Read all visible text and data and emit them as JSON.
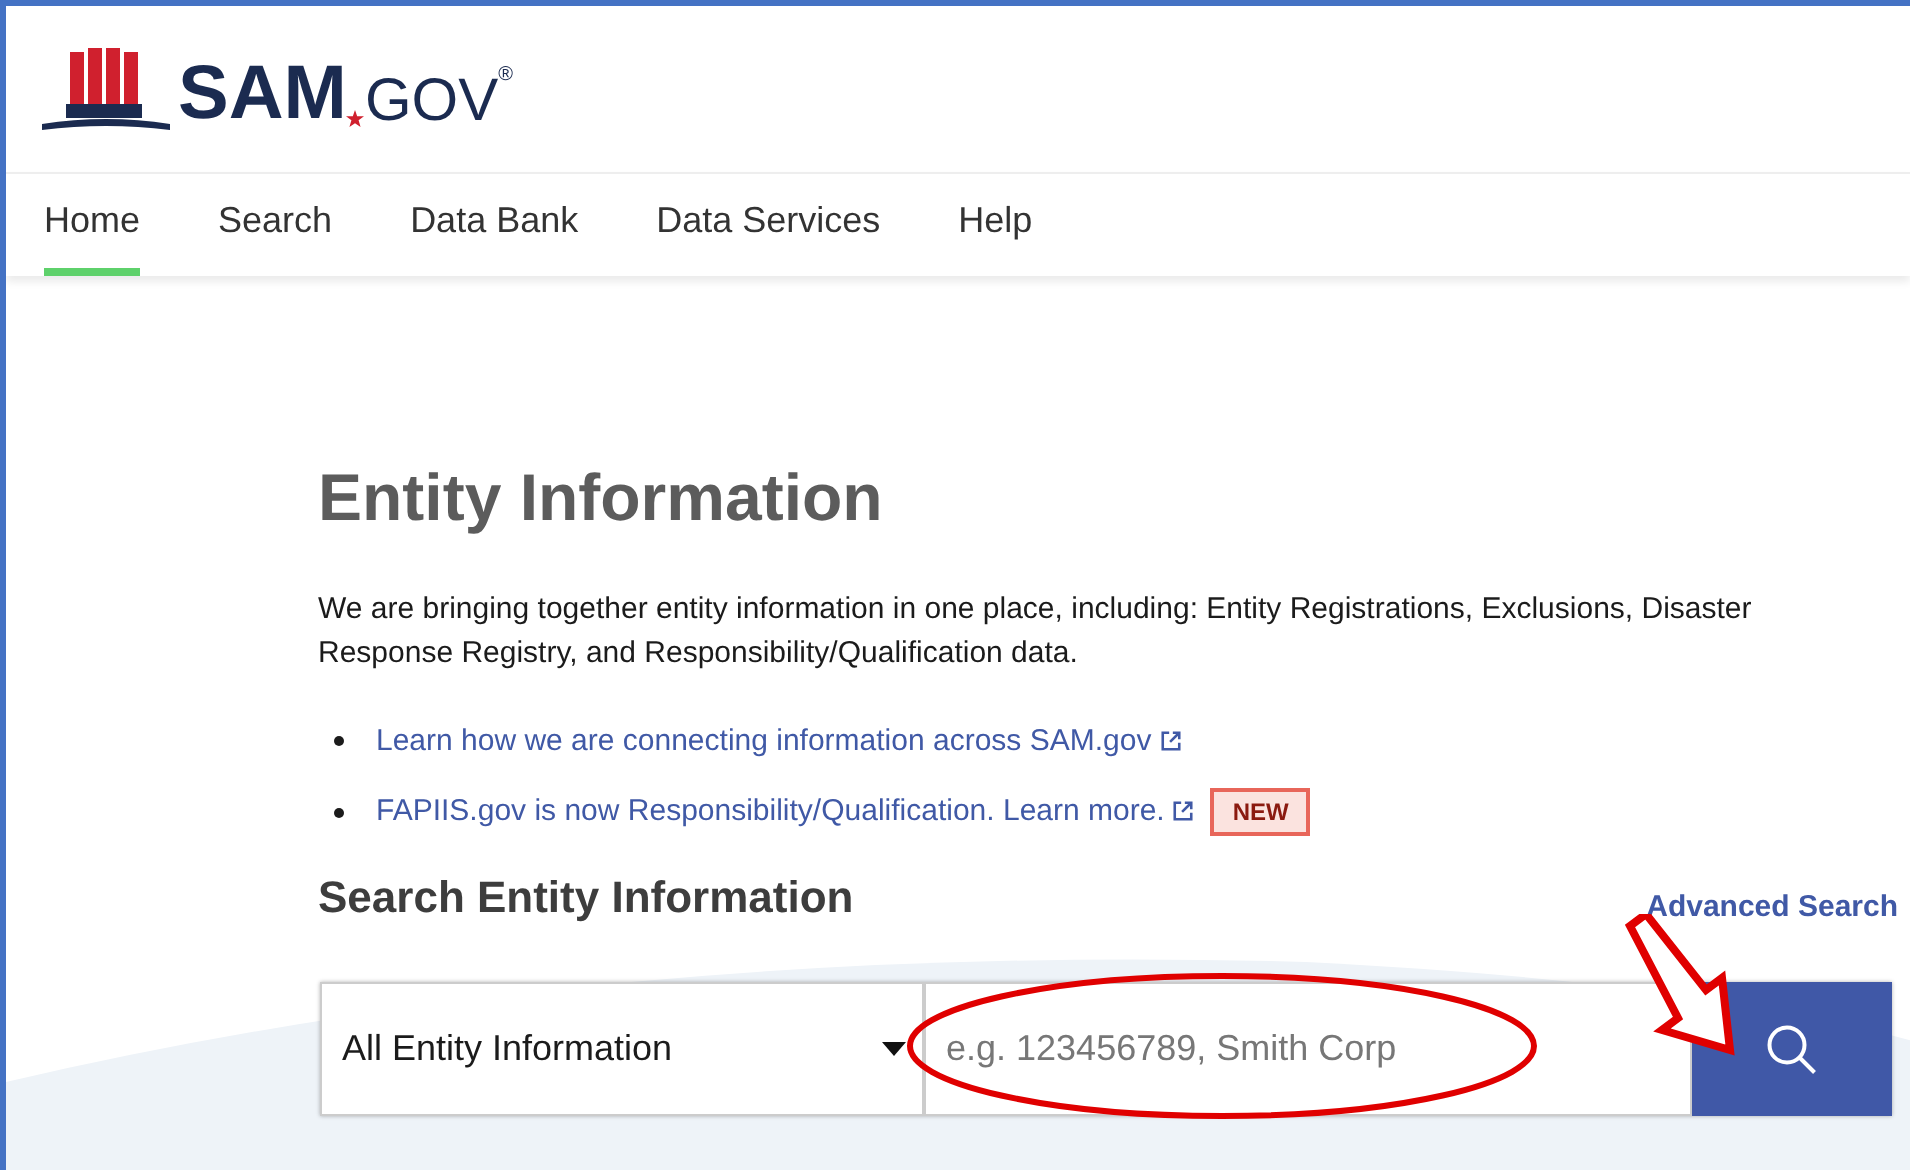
{
  "logo": {
    "name": "SAM",
    "suffix": "GOV",
    "mark": "®"
  },
  "nav": [
    {
      "label": "Home",
      "selected": true
    },
    {
      "label": "Search",
      "selected": false
    },
    {
      "label": "Data Bank",
      "selected": false
    },
    {
      "label": "Data Services",
      "selected": false
    },
    {
      "label": "Help",
      "selected": false
    }
  ],
  "title": "Entity Information",
  "intro": "We are bringing together entity information in one place, including: Entity Registrations, Exclusions, Disaster Response Registry, and Responsibility/Qualification data.",
  "links": [
    {
      "text": "Learn how we are connecting information across SAM.gov"
    },
    {
      "text": "FAPIIS.gov is now Responsibility/Qualification. Learn more.",
      "badge": "NEW"
    }
  ],
  "search": {
    "heading": "Search Entity Information",
    "advanced": "Advanced Search",
    "scope": "All Entity Information",
    "placeholder": "e.g. 123456789, Smith Corp"
  }
}
